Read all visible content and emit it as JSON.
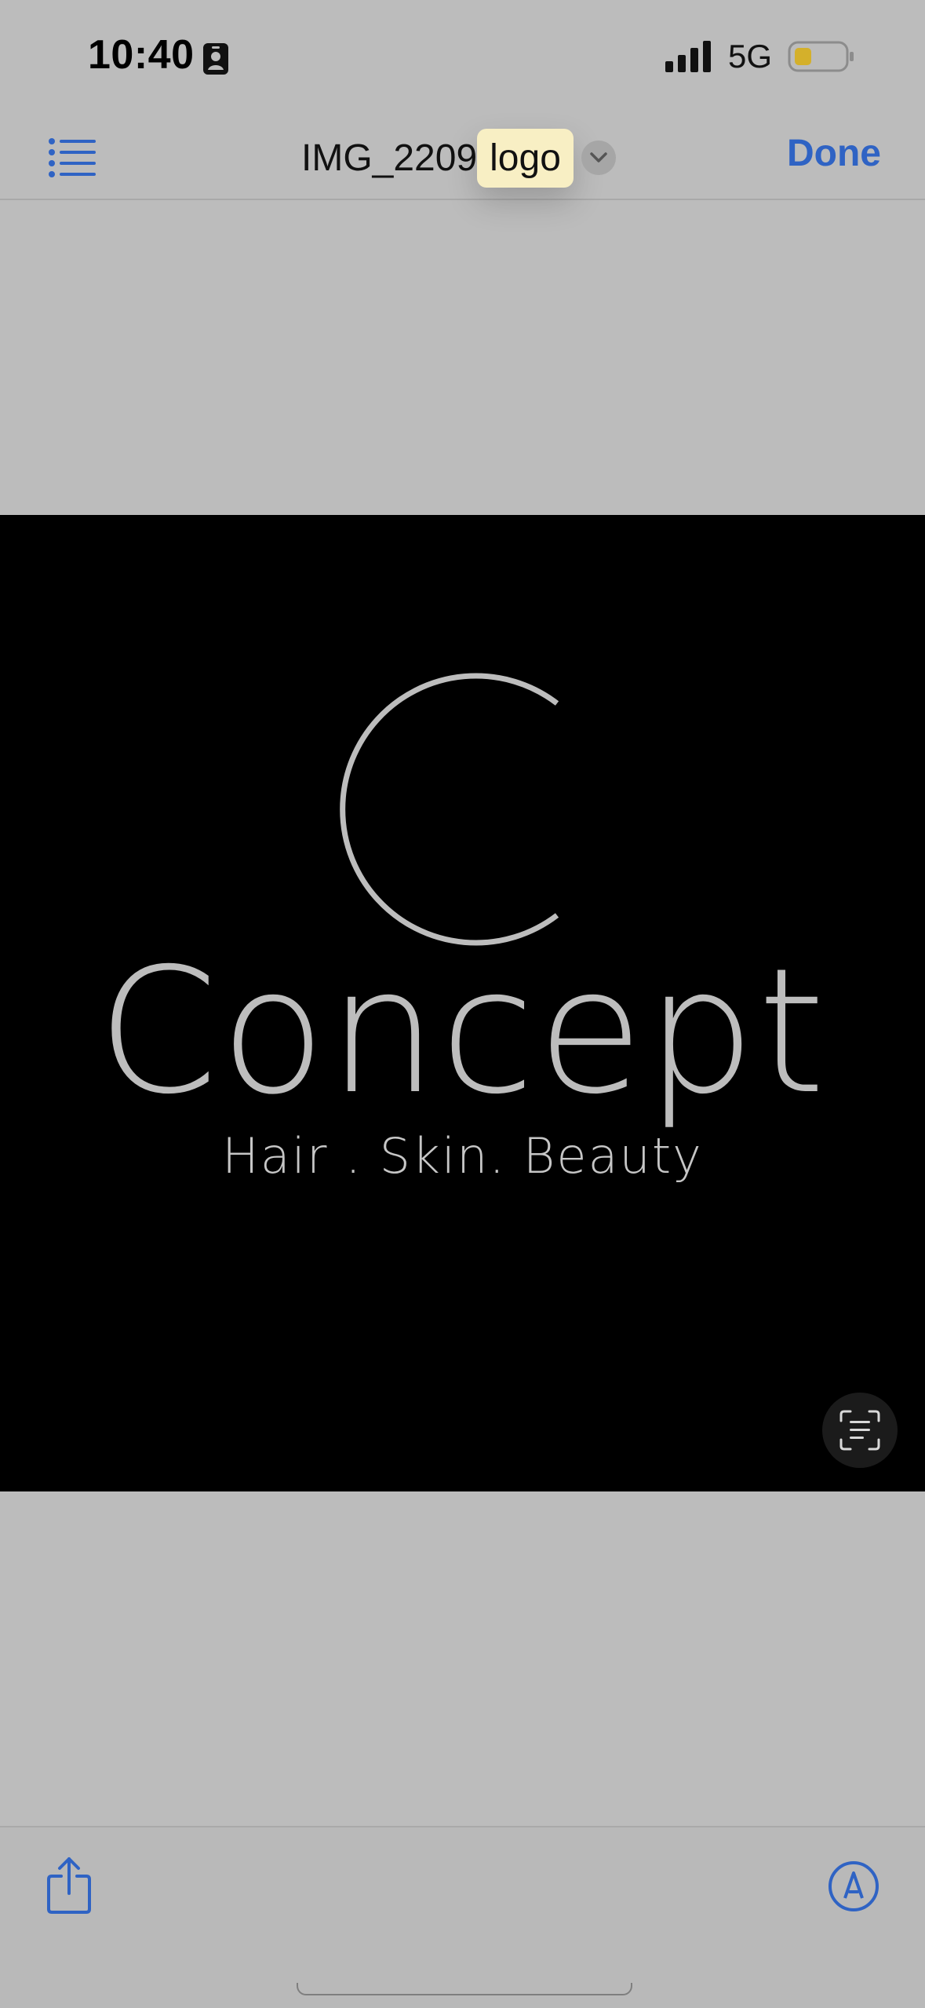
{
  "status_bar": {
    "time": "10:40",
    "network": "5G",
    "icons": [
      "id-card-icon",
      "signal-icon",
      "battery-icon"
    ]
  },
  "nav": {
    "list_icon": "list-icon",
    "title": "IMG_2209",
    "title_highlight": "logo",
    "chevron_icon": "chevron-down-icon",
    "done_label": "Done"
  },
  "image": {
    "logo_word": "Concept",
    "logo_tagline": "Hair . Skin. Beauty",
    "live_text_icon": "live-text-icon"
  },
  "toolbar": {
    "share_icon": "share-icon",
    "markup_icon": "markup-icon"
  },
  "colors": {
    "background": "#bcbcbc",
    "accent": "#2f63c4",
    "highlight": "#f8efc4",
    "image_bg": "#000000"
  }
}
